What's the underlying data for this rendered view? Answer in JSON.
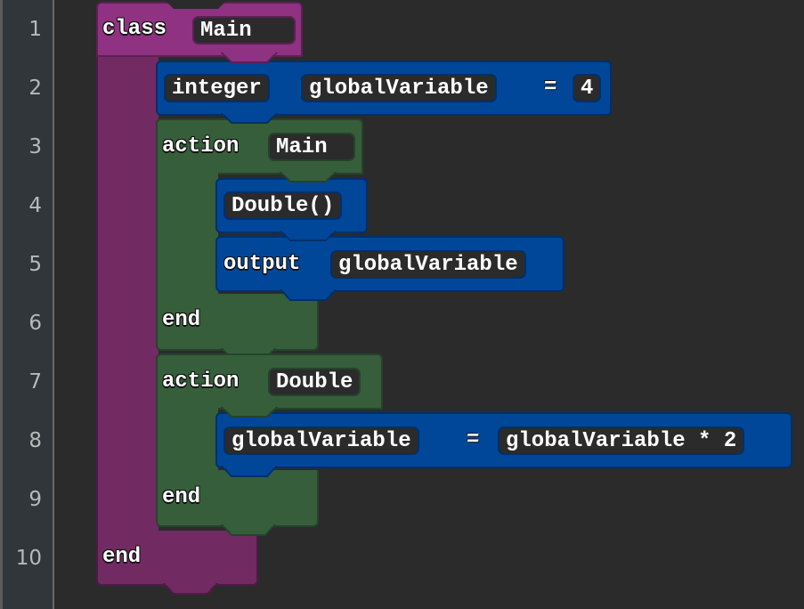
{
  "editor": {
    "line_numbers": [
      "1",
      "2",
      "3",
      "4",
      "5",
      "6",
      "7",
      "8",
      "9",
      "10"
    ],
    "colors": {
      "class_block": "#8e3281",
      "class_body": "#722a63",
      "statement_block": "#00479a",
      "action_block": "#365e3b",
      "slot_bg": "#2b2b2b",
      "editor_bg": "#2b2b2b",
      "gutter_bg": "#30363a"
    },
    "blocks": {
      "class_block": {
        "keyword": "class",
        "name": "Main",
        "end_label": "end"
      },
      "variable_declaration": {
        "type": "integer",
        "name": "globalVariable",
        "operator": "=",
        "value": "4"
      },
      "action_main": {
        "keyword": "action",
        "name": "Main",
        "end_label": "end"
      },
      "call_double": {
        "call": "Double()"
      },
      "output_statement": {
        "keyword": "output",
        "expression": "globalVariable"
      },
      "action_double": {
        "keyword": "action",
        "name": "Double",
        "end_label": "end"
      },
      "assignment": {
        "target": "globalVariable",
        "operator": "=",
        "expression": "globalVariable * 2"
      }
    }
  }
}
